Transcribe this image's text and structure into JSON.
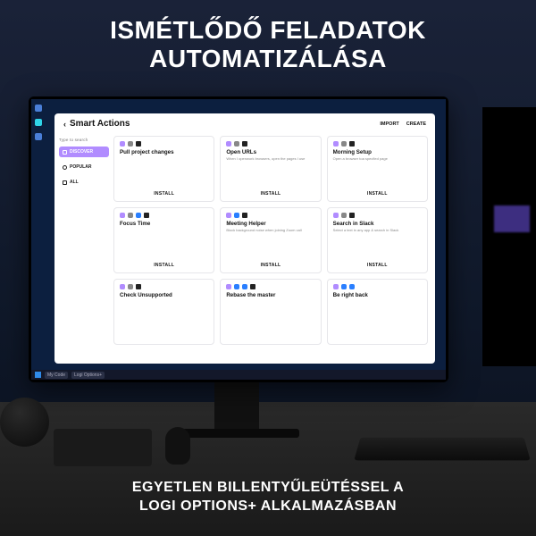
{
  "headline": {
    "line1": "ISMÉTLŐDŐ FELADATOK",
    "line2": "AUTOMATIZÁLÁSA"
  },
  "footer": {
    "line1": "EGYETLEN BILLENTYŰLEÜTÉSSEL A",
    "line2": "LOGI OPTIONS+ ALKALMAZÁSBAN"
  },
  "taskbar": {
    "items": [
      "My Code",
      "Logi Options+"
    ]
  },
  "app": {
    "title": "Smart Actions",
    "actions": {
      "import": "IMPORT",
      "create": "CREATE"
    }
  },
  "sidebar": {
    "search": "Type to search",
    "items": [
      {
        "label": "DISCOVER",
        "active": true
      },
      {
        "label": "POPULAR",
        "active": false
      },
      {
        "label": "ALL",
        "active": false
      }
    ]
  },
  "cards": [
    {
      "title": "Pull project changes",
      "sub": "",
      "btn": "INSTALL"
    },
    {
      "title": "Open URLs",
      "sub": "When I openwork browsers, open the pages I use",
      "btn": "INSTALL"
    },
    {
      "title": "Morning Setup",
      "sub": "Open a browser toa specfied page",
      "btn": "INSTALL"
    },
    {
      "title": "Focus Time",
      "sub": "",
      "btn": "INSTALL"
    },
    {
      "title": "Meeting Helper",
      "sub": "Block background noise when joining Zoom call",
      "btn": "INSTALL"
    },
    {
      "title": "Search in Slack",
      "sub": "Select a text in any app & search in Slack",
      "btn": "INSTALL"
    },
    {
      "title": "Check Unsupported",
      "sub": "",
      "btn": ""
    },
    {
      "title": "Rebase the master",
      "sub": "",
      "btn": ""
    },
    {
      "title": "Be right back",
      "sub": "",
      "btn": ""
    }
  ]
}
